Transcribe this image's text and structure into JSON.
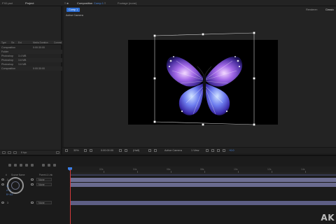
{
  "topbar": {
    "file_tab": "FX0.psd",
    "project_tab": "Project",
    "composition_tab": "Composition",
    "composition_name": "Comp 1",
    "footage_tab": "Footage (none)"
  },
  "project_panel": {
    "columns": [
      "Type",
      "Siz",
      "Ext",
      "Media Duration",
      "Comme"
    ],
    "rows": [
      {
        "type": "Composition",
        "size": "",
        "duration": "0:00:30:00"
      },
      {
        "type": "Folder",
        "size": "",
        "duration": ""
      },
      {
        "type": "Photoshop",
        "size": "3.4 MB",
        "duration": ""
      },
      {
        "type": "Photoshop",
        "size": "3.6 MB",
        "duration": ""
      },
      {
        "type": "Photoshop",
        "size": "3.6 MB",
        "duration": ""
      },
      {
        "type": "Composition",
        "size": "",
        "duration": "0:00:30:00"
      }
    ],
    "footer": "8 bpc"
  },
  "viewer": {
    "comp_chip": "Comp 1",
    "active_camera_label": "Active Camera",
    "resolution_label": "Renderer:",
    "renderer_value": "Classic"
  },
  "viewer_controls": {
    "zoom": "33%",
    "timecode": "0:00:00:00",
    "resolution": "(Half)",
    "camera": "Active Camera",
    "views": "1 View",
    "exposure": "+0.0"
  },
  "timeline": {
    "columns": [
      "#",
      "Source Name",
      "Parent & Link"
    ],
    "ruler_labels": [
      "02s",
      "04s",
      "06s",
      "08s",
      "10s",
      "12s",
      "14s",
      "16s",
      "18s"
    ],
    "layers": [
      {
        "index": "1",
        "parent": "None"
      },
      {
        "index": "2",
        "parent": "None"
      },
      {
        "index": "3",
        "parent": "None"
      }
    ],
    "cursor_text": [
      "1x",
      "A+:1",
      "B+:A2"
    ]
  },
  "watermark": "AK"
}
